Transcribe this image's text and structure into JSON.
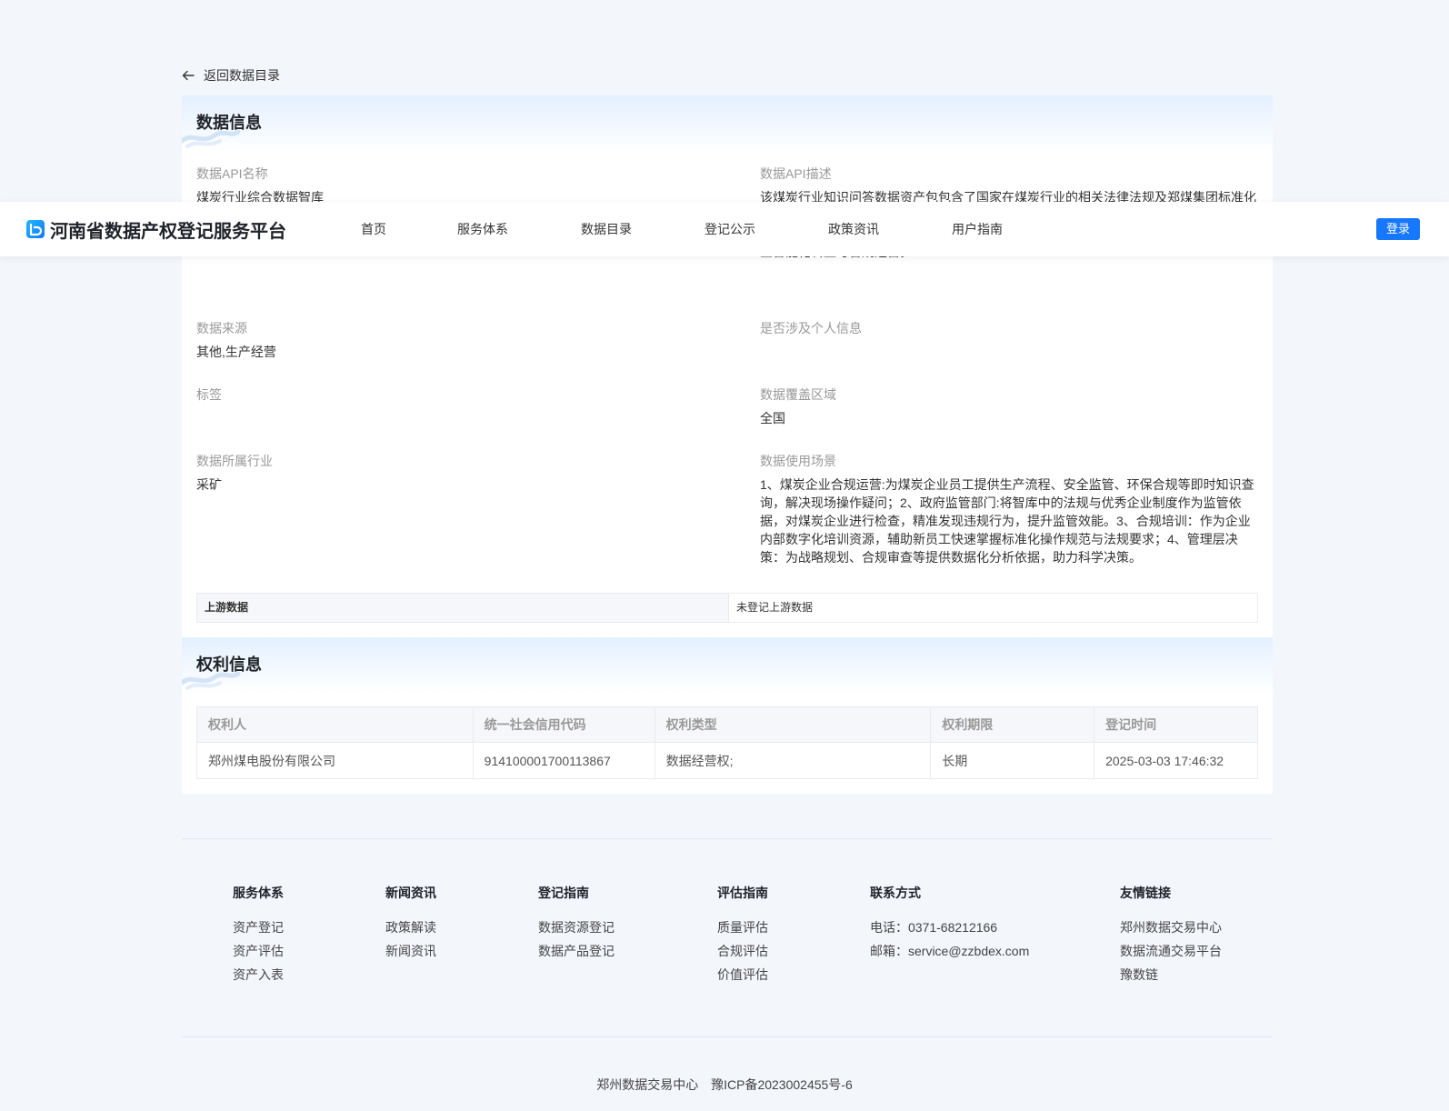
{
  "back_link": {
    "label": "返回数据目录"
  },
  "data_section": {
    "title": "数据信息",
    "fields": {
      "api_name": {
        "label": "数据API名称",
        "value": "煤炭行业综合数据智库"
      },
      "api_desc": {
        "label": "数据API描述",
        "value": "该煤炭行业知识问答数据资产包包含了国家在煤炭行业的相关法律法规及郑煤集团标准化管理制度的相关资料，能够为煤炭行业从业者提供法规与制度快速查询服务，提升合规效率，降低查询成本，同时为数字化培训、风险防控及运营决策提供数据支撑，推动煤炭行业智能化转型与合规运营。"
      },
      "source": {
        "label": "数据来源",
        "value": "其他,生产经营"
      },
      "personal_info": {
        "label": "是否涉及个人信息",
        "value": ""
      },
      "tags": {
        "label": "标签",
        "value": ""
      },
      "coverage": {
        "label": "数据覆盖区域",
        "value": "全国"
      },
      "industry": {
        "label": "数据所属行业",
        "value": "采矿"
      },
      "scenario": {
        "label": "数据使用场景",
        "value": "1、煤炭企业合规运营:为煤炭企业员工提供生产流程、安全监管、环保合规等即时知识查询，解决现场操作疑问；2、政府监管部门:将智库中的法规与优秀企业制度作为监管依据，对煤炭企业进行检查，精准发现违规行为，提升监管效能。3、合规培训：作为企业内部数字化培训资源，辅助新员工快速掌握标准化操作规范与法规要求；4、管理层决策：为战略规划、合规审查等提供数据化分析依据，助力科学决策。"
      }
    },
    "upstream": {
      "label": "上游数据",
      "value": "未登记上游数据"
    }
  },
  "rights_section": {
    "title": "权利信息",
    "columns": [
      "权利人",
      "统一社会信用代码",
      "权利类型",
      "权利期限",
      "登记时间"
    ],
    "rows": [
      [
        "郑州煤电股份有限公司",
        "914100001700113867",
        "数据经营权;",
        "长期",
        "2025-03-03 17:46:32"
      ]
    ]
  },
  "navbar": {
    "brand": "河南省数据产权登记服务平台",
    "items": [
      "首页",
      "服务体系",
      "数据目录",
      "登记公示",
      "政策资讯",
      "用户指南"
    ],
    "login": "登录"
  },
  "footer": {
    "columns": [
      {
        "title": "服务体系",
        "items": [
          "资产登记",
          "资产评估",
          "资产入表"
        ]
      },
      {
        "title": "新闻资讯",
        "items": [
          "政策解读",
          "新闻资讯"
        ]
      },
      {
        "title": "登记指南",
        "items": [
          "数据资源登记",
          "数据产品登记"
        ]
      },
      {
        "title": "评估指南",
        "items": [
          "质量评估",
          "合规评估",
          "价值评估"
        ]
      },
      {
        "title": "联系方式",
        "items": [
          "电话：0371-68212166",
          "邮箱：service@zzbdex.com"
        ]
      },
      {
        "title": "友情链接",
        "items": [
          "郑州数据交易中心",
          "数据流通交易平台",
          "豫数链"
        ]
      }
    ],
    "copyright": {
      "org": "郑州数据交易中心",
      "icp": "豫ICP备2023002455号-6"
    }
  },
  "colors": {
    "brand_blue": "#1677ff",
    "page_bg": "#f3f6fb"
  }
}
